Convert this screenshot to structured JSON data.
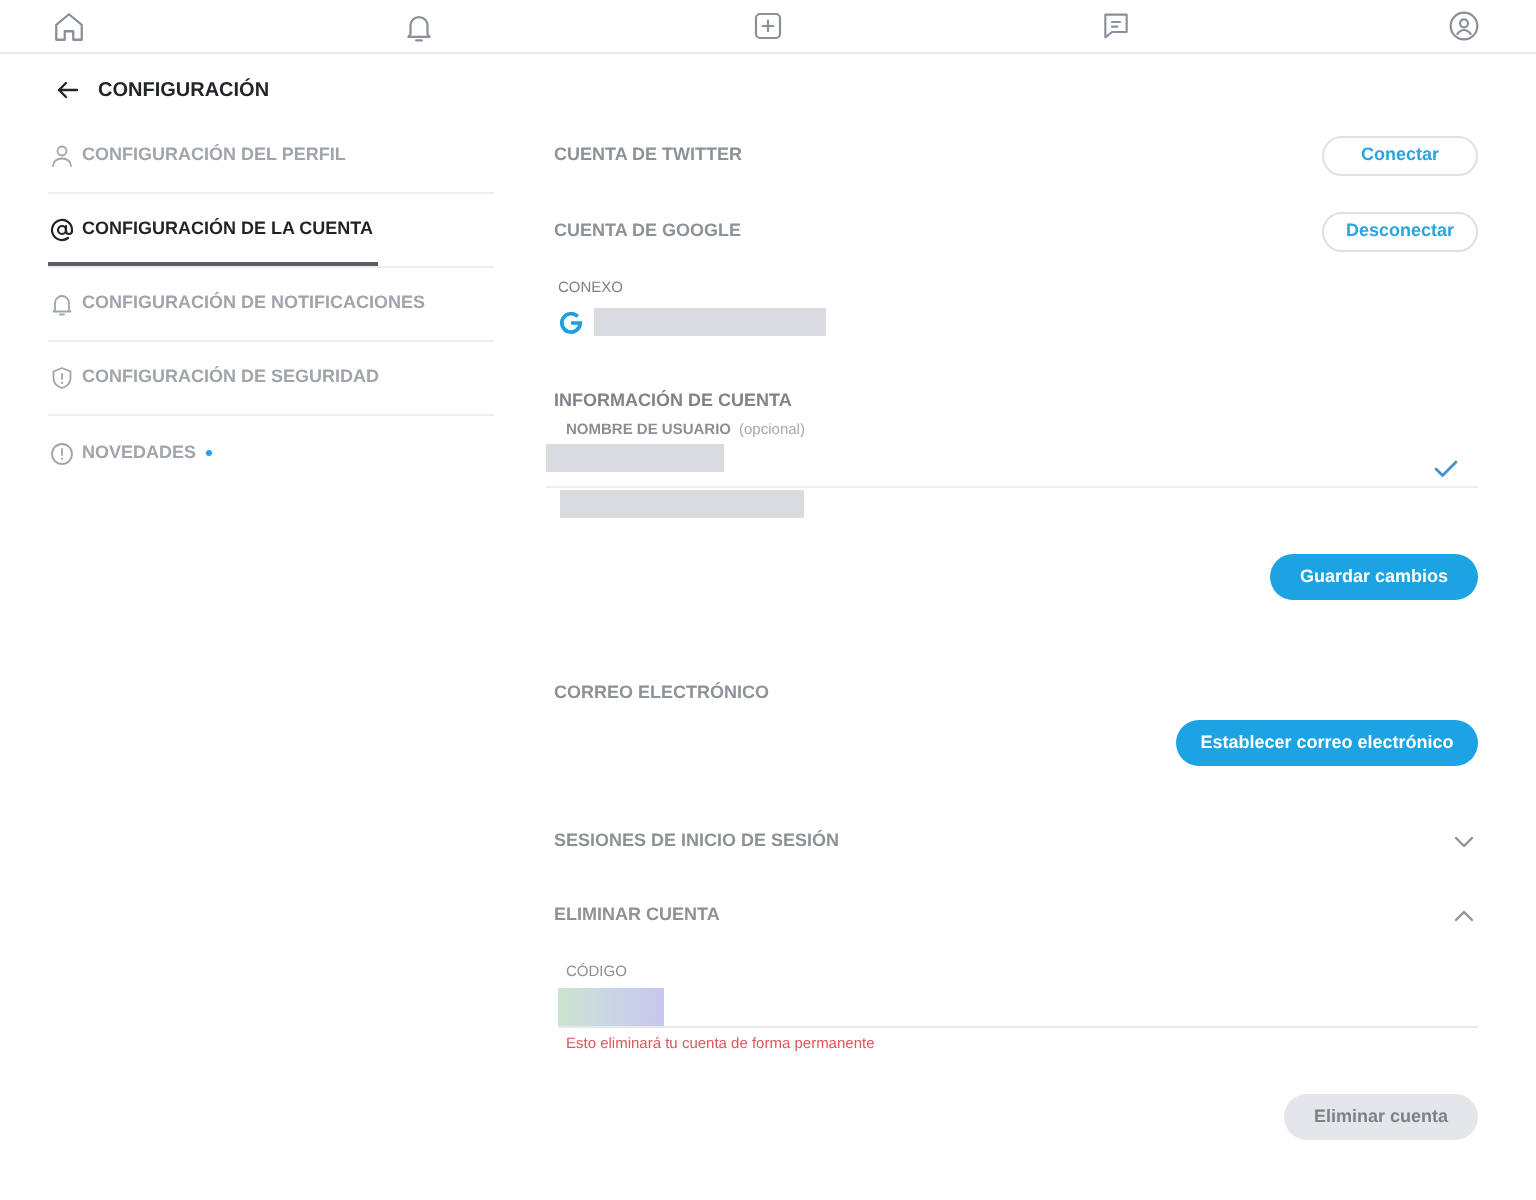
{
  "header": {
    "title": "CONFIGURACIÓN"
  },
  "sidebar": {
    "items": [
      {
        "label": "CONFIGURACIÓN DEL PERFIL",
        "selected": false,
        "unread": false
      },
      {
        "label": "CONFIGURACIÓN DE LA CUENTA",
        "selected": true,
        "unread": false
      },
      {
        "label": "CONFIGURACIÓN DE NOTIFICACIONES",
        "selected": false,
        "unread": false
      },
      {
        "label": "CONFIGURACIÓN DE SEGURIDAD",
        "selected": false,
        "unread": false
      },
      {
        "label": "NOVEDADES",
        "selected": false,
        "unread": true
      }
    ]
  },
  "twitter_account": {
    "title": "CUENTA DE TWITTER",
    "button": {
      "label": "Conectar",
      "kind": "outline"
    }
  },
  "google_account": {
    "title": "CUENTA DE GOOGLE",
    "button": {
      "label": "Desconectar",
      "kind": "outline"
    },
    "status": "CONEXO"
  },
  "account_info": {
    "title": "INFORMACIÓN DE CUENTA",
    "username": {
      "label": "NOMBRE DE USUARIO",
      "hint": "(opcional)",
      "valid": true
    },
    "button": {
      "label": "Guardar cambios",
      "kind": "primary"
    }
  },
  "email": {
    "title": "CORREO ELECTRÓNICO",
    "button": {
      "label": "Establecer correo electrónico",
      "kind": "primary"
    }
  },
  "sessions": {
    "title": "SESIONES DE INICIO DE SESIÓN",
    "expanded": false
  },
  "delete_account": {
    "title": "ELIMINAR CUENTA",
    "expanded": true,
    "code_label": "CÓDIGO",
    "warning": "Esto eliminará tu cuenta de forma permanente",
    "button": {
      "label": "Eliminar cuenta",
      "kind": "primary",
      "disabled": true
    }
  }
}
